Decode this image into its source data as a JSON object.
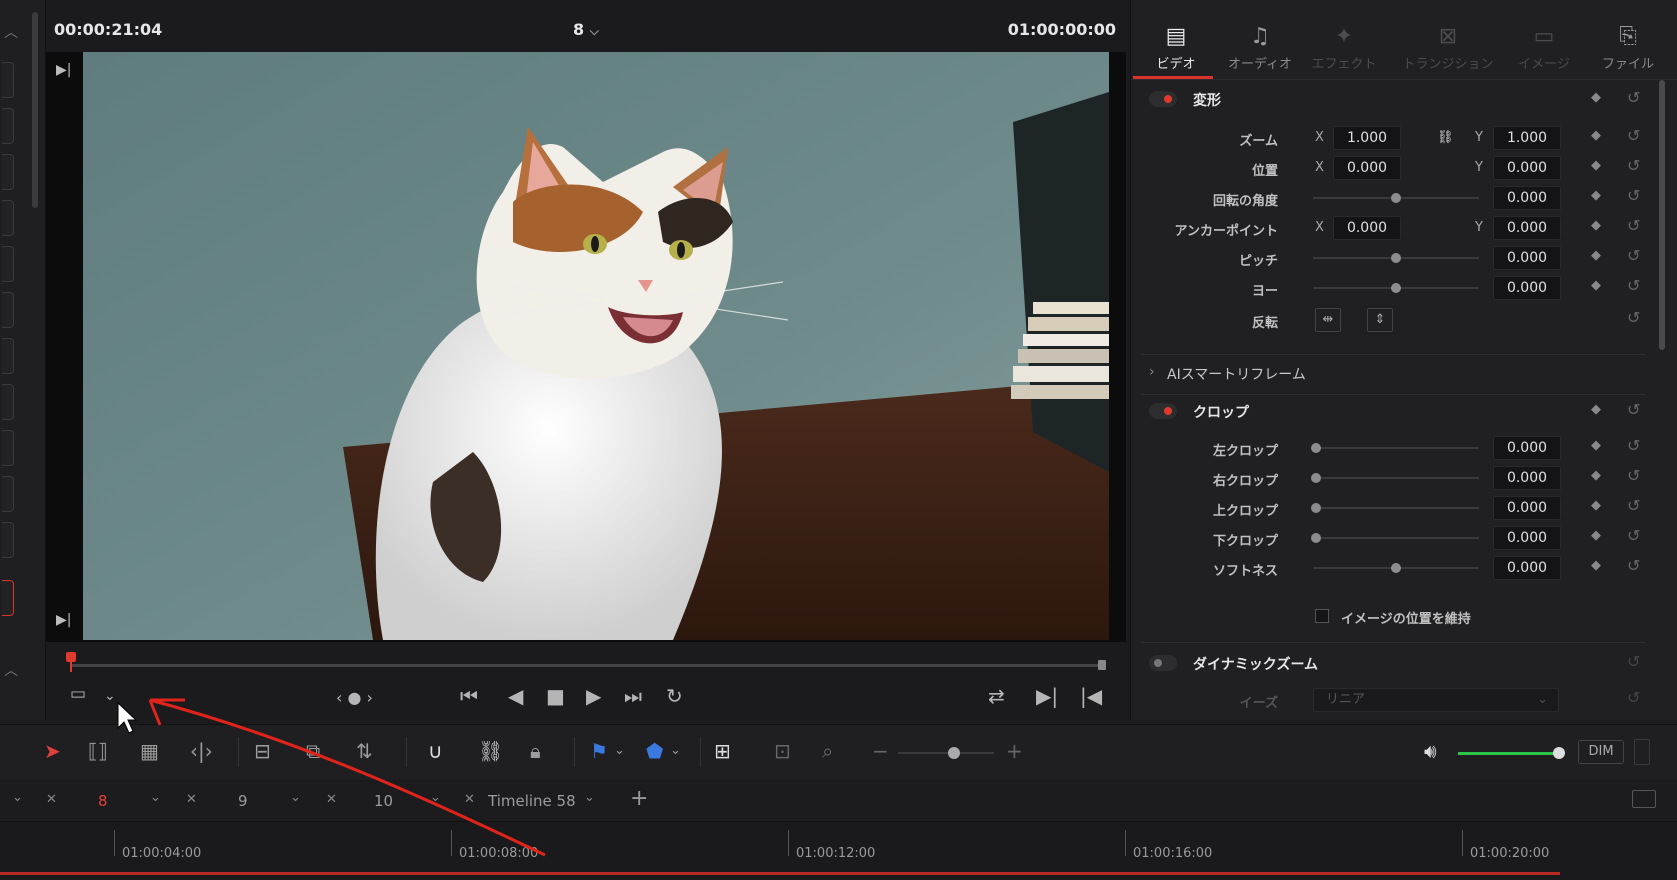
{
  "viewer": {
    "source_timecode": "00:00:21:04",
    "clip_selector": "8",
    "record_timecode": "01:00:00:00"
  },
  "inspector": {
    "tabs": [
      {
        "label": "ビデオ",
        "icon": "film-icon"
      },
      {
        "label": "オーディオ",
        "icon": "music-note-icon"
      },
      {
        "label": "エフェクト",
        "icon": "magic-wand-icon"
      },
      {
        "label": "トランジション",
        "icon": "transition-icon"
      },
      {
        "label": "イメージ",
        "icon": "image-icon"
      },
      {
        "label": "ファイル",
        "icon": "file-icon"
      }
    ],
    "transform": {
      "title": "変形",
      "zoom_label": "ズーム",
      "zoom_x": "1.000",
      "zoom_y": "1.000",
      "position_label": "位置",
      "position_x": "0.000",
      "position_y": "0.000",
      "rotation_label": "回転の角度",
      "rotation": "0.000",
      "anchor_label": "アンカーポイント",
      "anchor_x": "0.000",
      "anchor_y": "0.000",
      "pitch_label": "ピッチ",
      "pitch": "0.000",
      "yaw_label": "ヨー",
      "yaw": "0.000",
      "flip_label": "反転",
      "x_axis": "X",
      "y_axis": "Y"
    },
    "smart_reframe": "AIスマートリフレーム",
    "crop": {
      "title": "クロップ",
      "left_label": "左クロップ",
      "left": "0.000",
      "right_label": "右クロップ",
      "right": "0.000",
      "top_label": "上クロップ",
      "top": "0.000",
      "bottom_label": "下クロップ",
      "bottom": "0.000",
      "softness_label": "ソフトネス",
      "softness": "0.000",
      "retain_label": "イメージの位置を維持"
    },
    "dynamic_zoom": {
      "title": "ダイナミックズーム",
      "ease_label": "イーズ",
      "ease_value": "リニア"
    }
  },
  "toolbar": {
    "dim_label": "DIM",
    "volume_level": 0.95
  },
  "timeline_tabs": [
    {
      "name": "8",
      "active": true
    },
    {
      "name": "9",
      "active": false
    },
    {
      "name": "10",
      "active": false
    },
    {
      "name": "Timeline 58",
      "active": false
    }
  ],
  "ruler": {
    "labels": [
      "01:00:04:00",
      "01:00:08:00",
      "01:00:12:00",
      "01:00:16:00",
      "01:00:20:00"
    ]
  },
  "colors": {
    "accent": "#d9342b",
    "volume": "#2cc64a",
    "annotation": "#e0241b"
  }
}
